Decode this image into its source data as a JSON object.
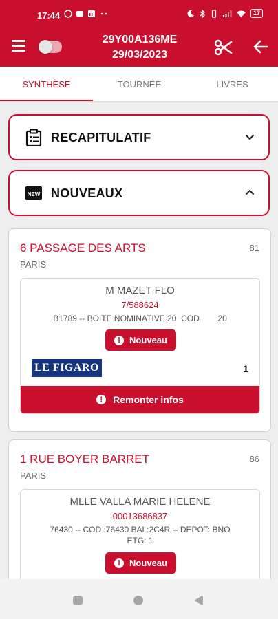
{
  "status_bar": {
    "time": "17:44",
    "battery": "17"
  },
  "toolbar": {
    "title_line1": "29Y00A136ME",
    "title_line2": "29/03/2023"
  },
  "tabs": [
    {
      "label": "SYNTHÈSE",
      "active": true
    },
    {
      "label": "TOURNEE",
      "active": false
    },
    {
      "label": "LIVRÉS",
      "active": false
    }
  ],
  "sections": {
    "recap": {
      "label": "RECAPITULATIF",
      "expanded": false
    },
    "nouveaux": {
      "label": "NOUVEAUX",
      "expanded": true,
      "icon_text": "NEW"
    }
  },
  "deliveries": [
    {
      "street": "6 PASSAGE DES ARTS",
      "number": "81",
      "city": "PARIS",
      "client": {
        "name": "M MAZET FLO",
        "ref": "7/588624",
        "detail": "B1789 -- BOITE NOMINATIVE 20  COD        20",
        "badge": "Nouveau",
        "publication": "LE FIGARO",
        "quantity": "1",
        "action": "Remonter infos"
      }
    },
    {
      "street": "1 RUE BOYER BARRET",
      "number": "86",
      "city": "PARIS",
      "client": {
        "name": "MLLE VALLA MARIE HELENE",
        "ref": "00013686837",
        "detail_line1": "76430 -- COD :76430  BAL:2C4R -- DEPOT: BNO",
        "detail_line2": "ETG: 1",
        "badge": "Nouveau"
      }
    }
  ],
  "colors": {
    "brand": "#c8102e",
    "background": "#eeeeee",
    "figaro_blue": "#16357a"
  },
  "icons": [
    "menu-icon",
    "toggle-switch",
    "scissors-icon",
    "back-arrow-icon",
    "clipboard-icon",
    "new-icon",
    "chevron-down-icon",
    "chevron-up-icon",
    "info-icon"
  ]
}
